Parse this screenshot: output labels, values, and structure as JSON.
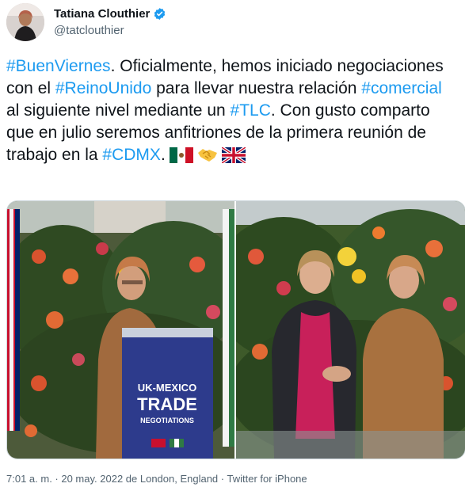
{
  "author": {
    "name": "Tatiana Clouthier",
    "handle": "@tatclouthier",
    "verified": true
  },
  "tweet": {
    "seg1": "#BuenViernes",
    "seg2": ". Oficialmente, hemos iniciado negociaciones con el ",
    "seg3": "#ReinoUnido",
    "seg4": " para llevar nuestra relación ",
    "seg5": "#comercial",
    "seg6": " al siguiente nivel mediante un ",
    "seg7": "#TLC",
    "seg8": ". Con gusto comparto que en julio seremos anfitriones de la primera reunión de trabajo en la ",
    "seg9": "#CDMX",
    "seg10": ".",
    "emojis": [
      "mexico-flag-icon",
      "handshake-icon",
      "uk-flag-icon"
    ]
  },
  "media": {
    "podium": {
      "line1": "UK-MEXICO",
      "line2": "TRADE",
      "line3": "NEGOTIATIONS"
    }
  },
  "meta": {
    "timestamp": "7:01 a. m. · 20 may. 2022 de London, England · Twitter for iPhone"
  },
  "colors": {
    "link": "#1d9bf0",
    "text": "#0f1419",
    "muted": "#536471",
    "verified": "#1d9bf0"
  }
}
